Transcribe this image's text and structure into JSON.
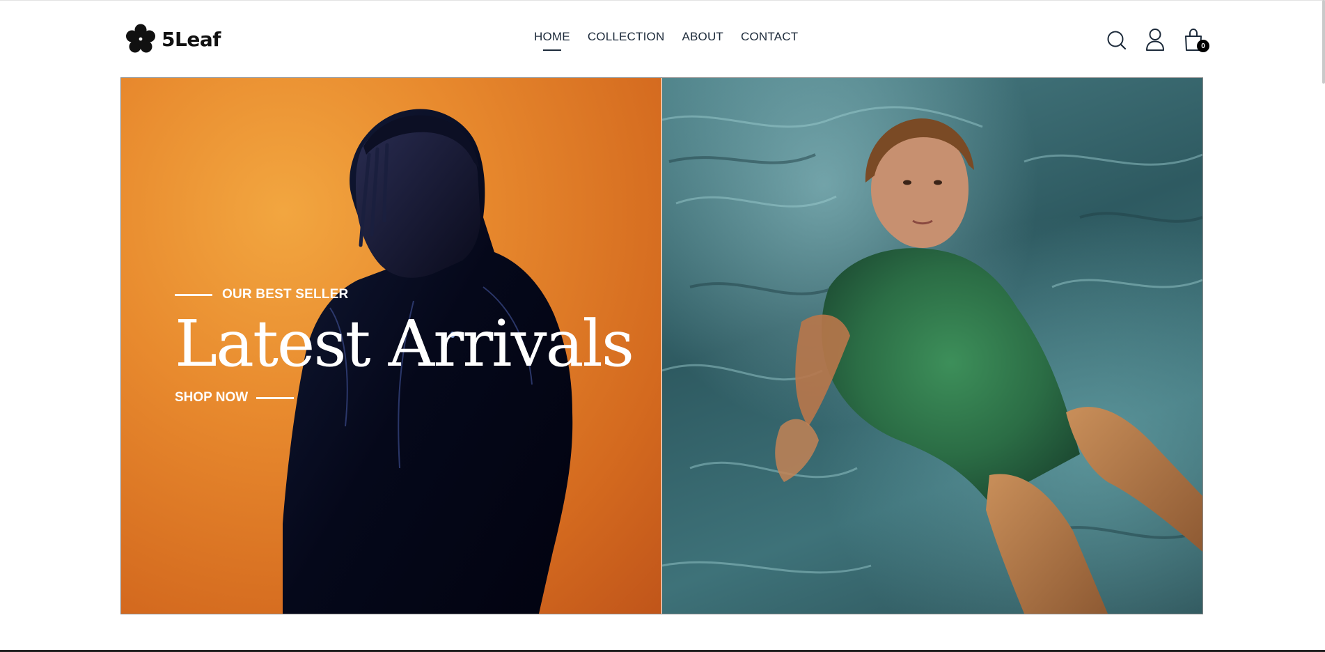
{
  "brand": {
    "name": "5Leaf",
    "logo_icon": "five-leaf-clover-icon"
  },
  "nav": {
    "items": [
      {
        "label": "HOME",
        "active": true
      },
      {
        "label": "COLLECTION",
        "active": false
      },
      {
        "label": "ABOUT",
        "active": false
      },
      {
        "label": "CONTACT",
        "active": false
      }
    ]
  },
  "header_icons": {
    "search": "search-icon",
    "account": "user-icon",
    "cart": "shopping-bag-icon",
    "cart_count": "0"
  },
  "hero": {
    "eyebrow": "OUR BEST SELLER",
    "headline": "Latest Arrivals",
    "cta": "SHOP NOW",
    "left_image": "man-in-dark-jacket-orange-background",
    "right_image": "woman-in-green-dress-floating-in-water"
  },
  "colors": {
    "text": "#1c2a3a",
    "left_panel": "#e88a2e",
    "right_panel": "#3e7279",
    "badge": "#000000"
  }
}
